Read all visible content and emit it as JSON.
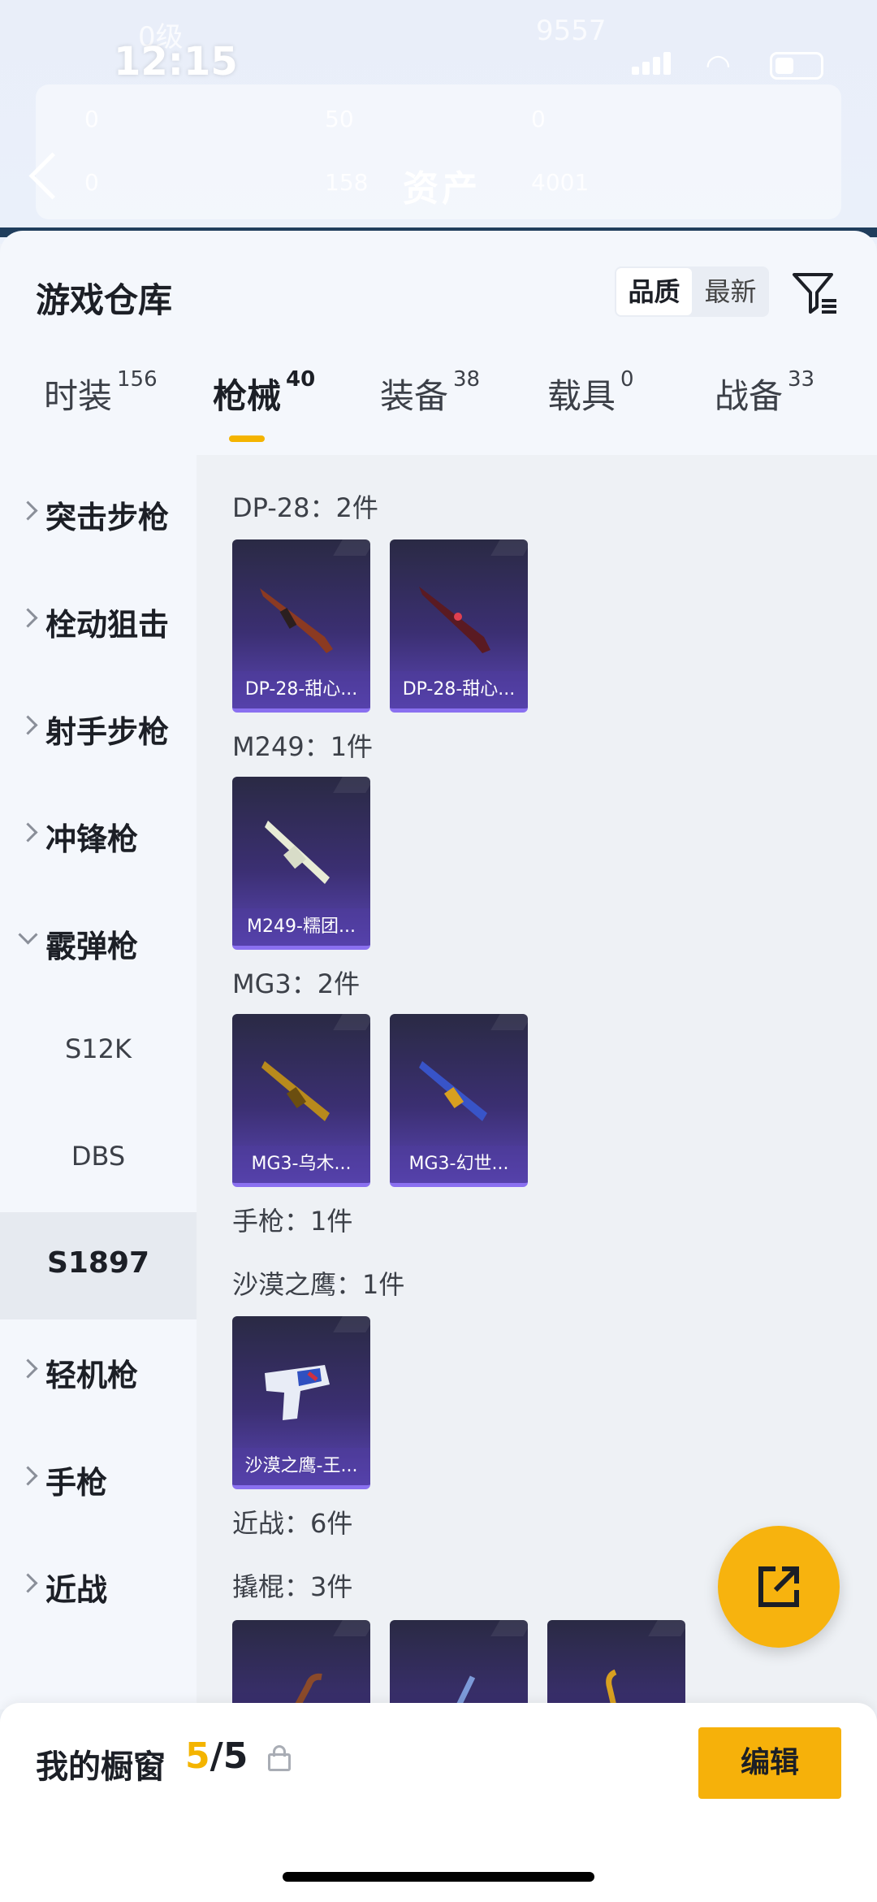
{
  "status": {
    "time": "12:15",
    "ghost_left": "0级",
    "ghost_right": "9557"
  },
  "header": {
    "title": "资产",
    "stats_row1": [
      "0",
      "50",
      "0"
    ],
    "stats_row2": [
      "0",
      "158",
      "4001"
    ]
  },
  "sheet": {
    "title": "游戏仓库",
    "sort": {
      "options": [
        "品质",
        "最新"
      ],
      "selected": "品质"
    }
  },
  "tabs": [
    {
      "label": "时装",
      "count": "156"
    },
    {
      "label": "枪械",
      "count": "40",
      "active": true
    },
    {
      "label": "装备",
      "count": "38"
    },
    {
      "label": "载具",
      "count": "0"
    },
    {
      "label": "战备",
      "count": "33"
    }
  ],
  "nav": {
    "items": [
      {
        "label": "突击步枪",
        "expanded": false
      },
      {
        "label": "栓动狙击",
        "expanded": false
      },
      {
        "label": "射手步枪",
        "expanded": false
      },
      {
        "label": "冲锋枪",
        "expanded": false
      },
      {
        "label": "霰弹枪",
        "expanded": true
      }
    ],
    "sub": [
      "S12K",
      "DBS",
      "S1897"
    ],
    "selected_sub": "S1897",
    "items_after": [
      {
        "label": "轻机枪"
      },
      {
        "label": "手枪"
      },
      {
        "label": "近战"
      }
    ]
  },
  "groups": {
    "dp28": "DP-28：2件",
    "m249": "M249：1件",
    "mg3": "MG3：2件",
    "pistol": "手枪：1件",
    "deagle": "沙漠之鹰：1件",
    "melee": "近战：6件",
    "crowbar": "撬棍：3件"
  },
  "cards": {
    "dp28_1": "DP-28-甜心...",
    "dp28_2": "DP-28-甜心...",
    "m249_1": "M249-糯团...",
    "mg3_1": "MG3-乌木...",
    "mg3_2": "MG3-幻世...",
    "deagle_1": "沙漠之鹰-王..."
  },
  "showcase": {
    "label": "我的橱窗",
    "current": "5",
    "total": "/5",
    "edit": "编辑"
  },
  "colors": {
    "accent": "#f4b400",
    "card_purple": "#5a46b4",
    "fab": "#f7b30e"
  }
}
